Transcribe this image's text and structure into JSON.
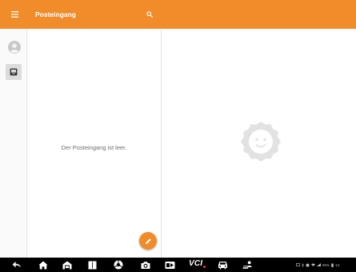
{
  "app": {
    "title": "Posteingang"
  },
  "colors": {
    "accent": "#f08c2a",
    "navbar": "#000000"
  },
  "toolbar": {
    "menu_icon": "hamburger-menu-icon",
    "search_icon": "search-icon"
  },
  "rail": {
    "items": [
      {
        "icon": "account-avatar-icon",
        "selected": false
      },
      {
        "icon": "inbox-icon",
        "selected": true
      }
    ]
  },
  "list": {
    "empty_message": "Der Posteingang ist leer.",
    "fab_icon": "pencil-compose-icon"
  },
  "detail": {
    "placeholder_icon": "sun-face-logo"
  },
  "navbar": {
    "icons": [
      "back-arrow-icon",
      "home-icon",
      "garage-icon",
      "recent-apps-icon",
      "browser-icon",
      "camera-icon",
      "screen-record-icon",
      "vci-icon",
      "car-icon",
      "diagnostic-user-icon"
    ],
    "vci_label": "VCI",
    "status": {
      "battery": "90%",
      "time": "12:"
    }
  }
}
